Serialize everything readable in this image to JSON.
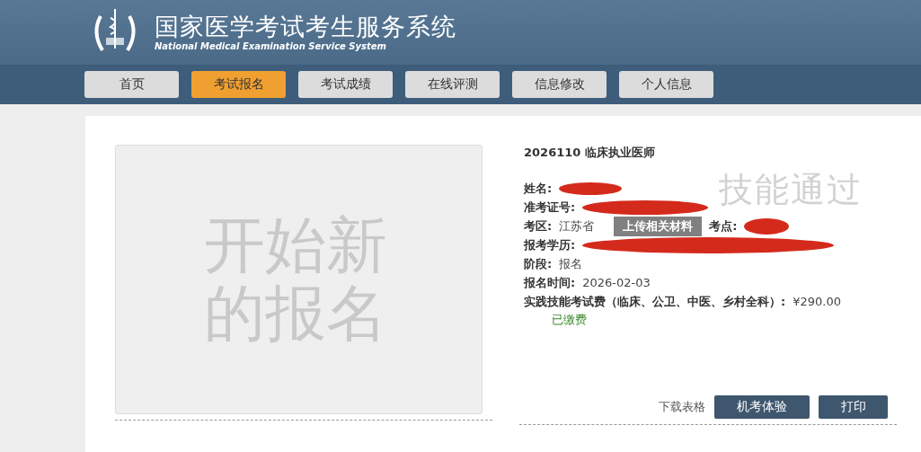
{
  "header": {
    "title": "国家医学考试考生服务系统",
    "subtitle": "National Medical Examination Service System"
  },
  "nav": [
    {
      "label": "首页",
      "selected": false
    },
    {
      "label": "考试报名",
      "selected": true
    },
    {
      "label": "考试成绩",
      "selected": false
    },
    {
      "label": "在线评测",
      "selected": false
    },
    {
      "label": "信息修改",
      "selected": false
    },
    {
      "label": "个人信息",
      "selected": false
    }
  ],
  "new_registration": {
    "label": "开始新的报名"
  },
  "exam": {
    "title": "2026110 临床执业医师",
    "stamp": "技能通过",
    "name_label": "姓名:",
    "ticket_label": "准考证号:",
    "region_label": "考区:",
    "region": "江苏省",
    "upload_button": "上传相关材料",
    "site_label": "考点:",
    "education_label": "报考学历:",
    "stage_label": "阶段:",
    "stage": "报名",
    "date_label": "报名时间:",
    "date": "2026-02-03",
    "fee_label": "实践技能考试费（临床、公卫、中医、乡村全科）:",
    "fee": "¥290.00",
    "paid_status": "已缴费"
  },
  "actions": {
    "download_link": "下载表格",
    "buttons": [
      "机考体验",
      "打印"
    ]
  }
}
